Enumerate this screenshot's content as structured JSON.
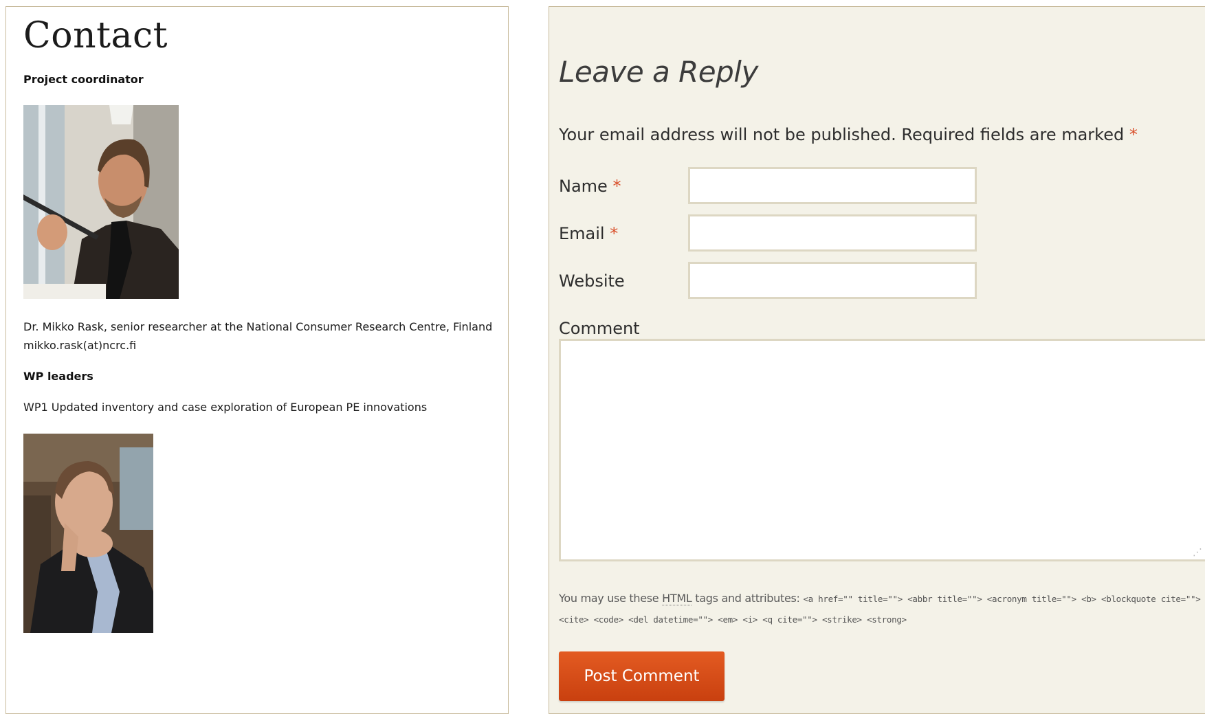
{
  "article": {
    "title": "Contact",
    "coordinator_heading": "Project coordinator",
    "coordinator_info_line1": "Dr. Mikko Rask, senior researcher at the National Consumer Research Centre, Finland",
    "coordinator_info_line2": "mikko.rask(at)ncrc.fi",
    "wp_heading": "WP leaders",
    "wp1_text": "WP1 Updated inventory and case exploration of European PE innovations"
  },
  "comment_form": {
    "title": "Leave a Reply",
    "notes_text": "Your email address will not be published. Required fields are marked",
    "required_marker": "*",
    "name_label": "Name",
    "email_label": "Email",
    "website_label": "Website",
    "comment_label": "Comment",
    "name_value": "",
    "email_value": "",
    "website_value": "",
    "comment_value": "",
    "allowed_tags_prefix": "You may use these",
    "allowed_tags_abbr": "HTML",
    "allowed_tags_suffix": "tags and attributes:",
    "allowed_tags_code": "<a href=\"\" title=\"\"> <abbr title=\"\"> <acronym title=\"\"> <b> <blockquote cite=\"\"> <cite> <code> <del datetime=\"\"> <em> <i> <q cite=\"\"> <strike> <strong>",
    "submit_label": "Post Comment"
  },
  "colors": {
    "accent": "#d9502b",
    "button": "#d4491a",
    "panel_background": "#f4f2e8",
    "border": "#c7b99a"
  }
}
